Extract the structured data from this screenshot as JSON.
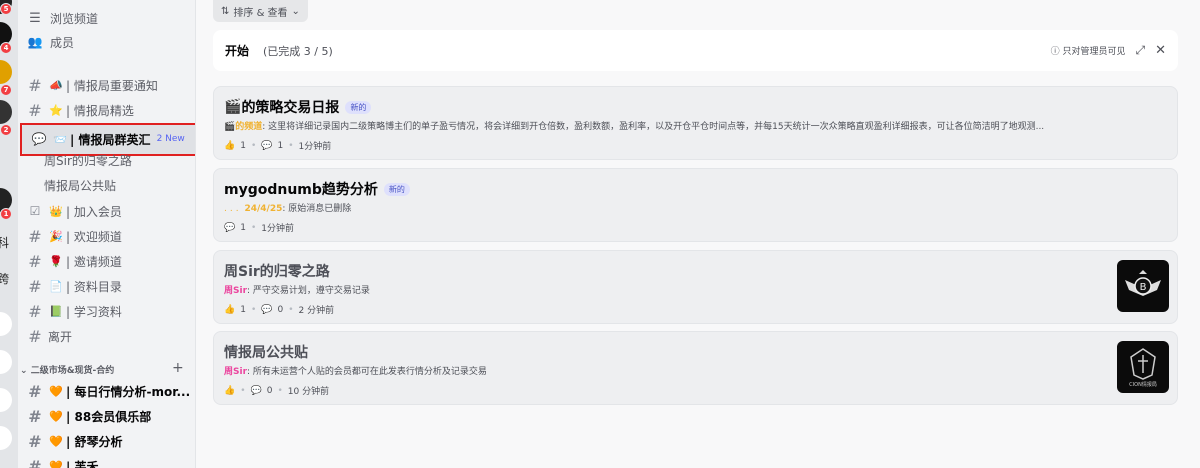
{
  "rail": {
    "badges": [
      "5",
      "4",
      "7",
      "2",
      "1"
    ],
    "chars": [
      "科",
      "跨"
    ]
  },
  "sidebar": {
    "top_items": [
      {
        "icon": "browse-channels-icon",
        "label": "浏览频道"
      },
      {
        "icon": "members-icon",
        "label": "成员"
      }
    ],
    "channels": [
      {
        "emoji": "📣",
        "label": "| 情报局重要通知"
      },
      {
        "emoji": "⭐",
        "label": "| 情报局精选"
      },
      {
        "emoji": "📨",
        "label": "| 情报局群英汇",
        "new_badge": "2 New",
        "selected": true
      }
    ],
    "threads": [
      "周Sir的归零之路",
      "情报局公共贴"
    ],
    "channels2": [
      {
        "emoji": "👑",
        "label": "| 加入会员"
      },
      {
        "emoji": "🎉",
        "label": "| 欢迎频道"
      },
      {
        "emoji": "🌹",
        "label": "| 邀请频道"
      },
      {
        "emoji": "📄",
        "label": "| 资料目录"
      },
      {
        "emoji": "📗",
        "label": "| 学习资料"
      },
      {
        "emoji": "",
        "label": "离开"
      }
    ],
    "category": "二级市场&现货-合约",
    "category_channels": [
      {
        "emoji": "🧡",
        "label": "| 每日行情分析-mor..."
      },
      {
        "emoji": "🧡",
        "label": "| 88会员俱乐部"
      },
      {
        "emoji": "🧡",
        "label": "| 舒琴分析"
      },
      {
        "emoji": "🧡",
        "label": "| 芙禾"
      }
    ]
  },
  "toolbar": {
    "sort_label": "排序 & 查看"
  },
  "onboarding": {
    "title": "开始",
    "progress": "(已完成 3 / 5)",
    "admin_note": "只对管理员可见"
  },
  "posts": [
    {
      "title": "的策略交易日报",
      "title_emoji": "🎬",
      "tag": "新的",
      "author": "的频道",
      "author_color": "#f0b232",
      "preview": ": 这里将详细记录国内二级策略博主们的单子盈亏情况，将会详细到开仓倍数，盈利数额，盈利率，以及开仓平仓时间点等，并每15天统计一次众策略直观盈利详细报表，可让各位简洁明了地观测...",
      "reactions": "1",
      "comments": "1",
      "time": "1分钟前",
      "has_thumb": false
    },
    {
      "title": "mygodnumb趋势分析",
      "tag": "新的",
      "author": "24/4/25",
      "author_color": "#f0b232",
      "preview": ": 原始消息已删除",
      "comments": "1",
      "time": "1分钟前",
      "has_thumb": false
    },
    {
      "title": "周Sir的归零之路",
      "author": "周Sir",
      "author_color": "#eb459e",
      "preview": ":  严守交易计划，遵守交易记录",
      "reactions": "1",
      "comments": "0",
      "time": "2 分钟前",
      "has_thumb": true
    },
    {
      "title": "情报局公共贴",
      "author": "周Sir",
      "author_color": "#eb459e",
      "preview": ": 所有未运营个人贴的会员都可在此发表行情分析及记录交易",
      "comments": "0",
      "time": "10 分钟前",
      "has_thumb": true,
      "thumb_text": "CION情报局"
    }
  ],
  "colors": {
    "accent": "#5865f2",
    "highlight_border": "#e02020",
    "tag_bg": "#dee0fc"
  }
}
